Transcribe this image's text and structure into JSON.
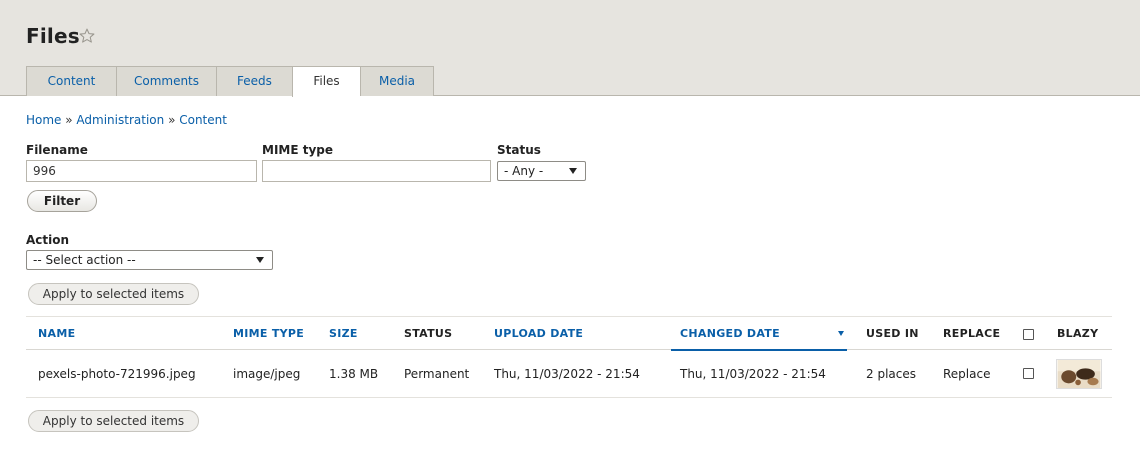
{
  "header": {
    "title": "Files",
    "tabs": [
      {
        "label": "Content"
      },
      {
        "label": "Comments"
      },
      {
        "label": "Feeds"
      },
      {
        "label": "Files"
      },
      {
        "label": "Media"
      }
    ],
    "active_tab": "Files"
  },
  "breadcrumb": [
    "Home",
    "Administration",
    "Content"
  ],
  "filters": {
    "filename": {
      "label": "Filename",
      "value": "996"
    },
    "mime": {
      "label": "MIME type",
      "value": ""
    },
    "status": {
      "label": "Status",
      "selected": "- Any -"
    },
    "filter_button": "Filter"
  },
  "bulk": {
    "action_label": "Action",
    "action_selected": "-- Select action --",
    "apply_label": "Apply to selected items"
  },
  "table": {
    "columns": [
      "NAME",
      "MIME TYPE",
      "SIZE",
      "STATUS",
      "UPLOAD DATE",
      "CHANGED DATE",
      "USED IN",
      "REPLACE",
      "BLAZY"
    ],
    "rows": [
      {
        "name": "pexels-photo-721996.jpeg",
        "mime": "image/jpeg",
        "size": "1.38 MB",
        "status": "Permanent",
        "upload_date": "Thu, 11/03/2022 - 21:54",
        "changed_date": "Thu, 11/03/2022 - 21:54",
        "used_in": "2 places",
        "replace": "Replace"
      }
    ]
  },
  "colors": {
    "link": "#0a5fa8",
    "header_bg": "#e6e4df"
  },
  "icons": {
    "title_star": "star-outline-icon",
    "sort": "sort-descending-icon"
  }
}
